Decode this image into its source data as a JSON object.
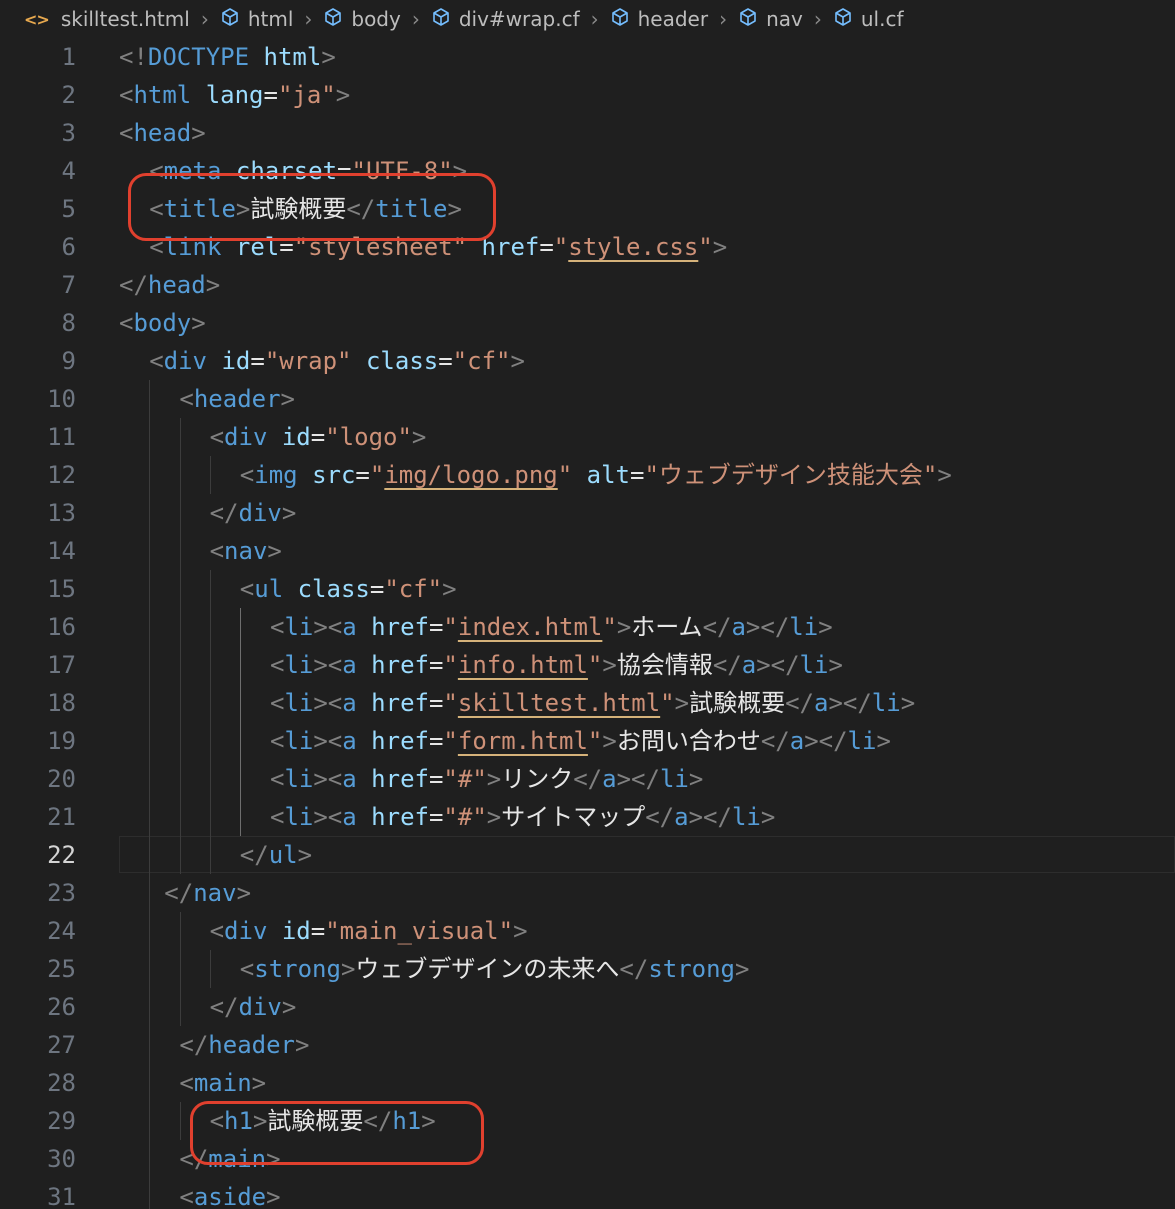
{
  "breadcrumb": {
    "file_icon": "<>",
    "items": [
      "skilltest.html",
      "html",
      "body",
      "div#wrap.cf",
      "header",
      "nav",
      "ul.cf"
    ]
  },
  "editor": {
    "current_line": 22,
    "lines": [
      {
        "n": "1",
        "indent": 0,
        "tokens": [
          [
            "t",
            "<!"
          ],
          [
            "tag",
            "DOCTYPE"
          ],
          [
            "t",
            " "
          ],
          [
            "attr",
            "html"
          ],
          [
            "t",
            ">"
          ]
        ]
      },
      {
        "n": "2",
        "indent": 0,
        "tokens": [
          [
            "t",
            "<"
          ],
          [
            "tag",
            "html"
          ],
          [
            "t",
            " "
          ],
          [
            "attr",
            "lang"
          ],
          [
            "txt",
            "="
          ],
          [
            "str",
            "\"ja\""
          ],
          [
            "t",
            ">"
          ]
        ]
      },
      {
        "n": "3",
        "indent": 0,
        "tokens": [
          [
            "t",
            "<"
          ],
          [
            "tag",
            "head"
          ],
          [
            "t",
            ">"
          ]
        ]
      },
      {
        "n": "4",
        "indent": 1,
        "tokens": [
          [
            "t",
            "<"
          ],
          [
            "tag",
            "meta"
          ],
          [
            "t",
            " "
          ],
          [
            "attr",
            "charset"
          ],
          [
            "txt",
            "="
          ],
          [
            "str",
            "\"UTF-8\""
          ],
          [
            "t",
            ">"
          ]
        ]
      },
      {
        "n": "5",
        "indent": 1,
        "tokens": [
          [
            "t",
            "<"
          ],
          [
            "tag",
            "title"
          ],
          [
            "t",
            ">"
          ],
          [
            "txt",
            "試験概要"
          ],
          [
            "t",
            "</"
          ],
          [
            "tag",
            "title"
          ],
          [
            "t",
            ">"
          ]
        ]
      },
      {
        "n": "6",
        "indent": 1,
        "tokens": [
          [
            "t",
            "<"
          ],
          [
            "tag",
            "link"
          ],
          [
            "t",
            " "
          ],
          [
            "attr",
            "rel"
          ],
          [
            "txt",
            "="
          ],
          [
            "str",
            "\"stylesheet\""
          ],
          [
            "t",
            " "
          ],
          [
            "attr",
            "href"
          ],
          [
            "txt",
            "="
          ],
          [
            "str",
            "\""
          ],
          [
            "link",
            "style.css"
          ],
          [
            "str",
            "\""
          ],
          [
            "t",
            ">"
          ]
        ]
      },
      {
        "n": "7",
        "indent": 0,
        "tokens": [
          [
            "t",
            "</"
          ],
          [
            "tag",
            "head"
          ],
          [
            "t",
            ">"
          ]
        ]
      },
      {
        "n": "8",
        "indent": 0,
        "tokens": [
          [
            "t",
            "<"
          ],
          [
            "tag",
            "body"
          ],
          [
            "t",
            ">"
          ]
        ]
      },
      {
        "n": "9",
        "indent": 1,
        "tokens": [
          [
            "t",
            "<"
          ],
          [
            "tag",
            "div"
          ],
          [
            "t",
            " "
          ],
          [
            "attr",
            "id"
          ],
          [
            "txt",
            "="
          ],
          [
            "str",
            "\"wrap\""
          ],
          [
            "t",
            " "
          ],
          [
            "attr",
            "class"
          ],
          [
            "txt",
            "="
          ],
          [
            "str",
            "\"cf\""
          ],
          [
            "t",
            ">"
          ]
        ]
      },
      {
        "n": "10",
        "indent": 2,
        "tokens": [
          [
            "t",
            "<"
          ],
          [
            "tag",
            "header"
          ],
          [
            "t",
            ">"
          ]
        ]
      },
      {
        "n": "11",
        "indent": 3,
        "tokens": [
          [
            "t",
            "<"
          ],
          [
            "tag",
            "div"
          ],
          [
            "t",
            " "
          ],
          [
            "attr",
            "id"
          ],
          [
            "txt",
            "="
          ],
          [
            "str",
            "\"logo\""
          ],
          [
            "t",
            ">"
          ]
        ]
      },
      {
        "n": "12",
        "indent": 4,
        "tokens": [
          [
            "t",
            "<"
          ],
          [
            "tag",
            "img"
          ],
          [
            "t",
            " "
          ],
          [
            "attr",
            "src"
          ],
          [
            "txt",
            "="
          ],
          [
            "str",
            "\""
          ],
          [
            "link",
            "img/logo.png"
          ],
          [
            "str",
            "\""
          ],
          [
            "t",
            " "
          ],
          [
            "attr",
            "alt"
          ],
          [
            "txt",
            "="
          ],
          [
            "str",
            "\"ウェブデザイン技能大会\""
          ],
          [
            "t",
            ">"
          ]
        ]
      },
      {
        "n": "13",
        "indent": 3,
        "tokens": [
          [
            "t",
            "</"
          ],
          [
            "tag",
            "div"
          ],
          [
            "t",
            ">"
          ]
        ]
      },
      {
        "n": "14",
        "indent": 3,
        "tokens": [
          [
            "t",
            "<"
          ],
          [
            "tag",
            "nav"
          ],
          [
            "t",
            ">"
          ]
        ]
      },
      {
        "n": "15",
        "indent": 4,
        "tokens": [
          [
            "t",
            "<"
          ],
          [
            "tag",
            "ul"
          ],
          [
            "t",
            " "
          ],
          [
            "attr",
            "class"
          ],
          [
            "txt",
            "="
          ],
          [
            "str",
            "\"cf\""
          ],
          [
            "t",
            ">"
          ]
        ]
      },
      {
        "n": "16",
        "indent": 5,
        "tokens": [
          [
            "t",
            "<"
          ],
          [
            "tag",
            "li"
          ],
          [
            "t",
            "><"
          ],
          [
            "tag",
            "a"
          ],
          [
            "t",
            " "
          ],
          [
            "attr",
            "href"
          ],
          [
            "txt",
            "="
          ],
          [
            "str",
            "\""
          ],
          [
            "link",
            "index.html"
          ],
          [
            "str",
            "\""
          ],
          [
            "t",
            ">"
          ],
          [
            "txt",
            "ホーム"
          ],
          [
            "t",
            "</"
          ],
          [
            "tag",
            "a"
          ],
          [
            "t",
            "></"
          ],
          [
            "tag",
            "li"
          ],
          [
            "t",
            ">"
          ]
        ]
      },
      {
        "n": "17",
        "indent": 5,
        "tokens": [
          [
            "t",
            "<"
          ],
          [
            "tag",
            "li"
          ],
          [
            "t",
            "><"
          ],
          [
            "tag",
            "a"
          ],
          [
            "t",
            " "
          ],
          [
            "attr",
            "href"
          ],
          [
            "txt",
            "="
          ],
          [
            "str",
            "\""
          ],
          [
            "link",
            "info.html"
          ],
          [
            "str",
            "\""
          ],
          [
            "t",
            ">"
          ],
          [
            "txt",
            "協会情報"
          ],
          [
            "t",
            "</"
          ],
          [
            "tag",
            "a"
          ],
          [
            "t",
            "></"
          ],
          [
            "tag",
            "li"
          ],
          [
            "t",
            ">"
          ]
        ]
      },
      {
        "n": "18",
        "indent": 5,
        "tokens": [
          [
            "t",
            "<"
          ],
          [
            "tag",
            "li"
          ],
          [
            "t",
            "><"
          ],
          [
            "tag",
            "a"
          ],
          [
            "t",
            " "
          ],
          [
            "attr",
            "href"
          ],
          [
            "txt",
            "="
          ],
          [
            "str",
            "\""
          ],
          [
            "link",
            "skilltest.html"
          ],
          [
            "str",
            "\""
          ],
          [
            "t",
            ">"
          ],
          [
            "txt",
            "試験概要"
          ],
          [
            "t",
            "</"
          ],
          [
            "tag",
            "a"
          ],
          [
            "t",
            "></"
          ],
          [
            "tag",
            "li"
          ],
          [
            "t",
            ">"
          ]
        ]
      },
      {
        "n": "19",
        "indent": 5,
        "tokens": [
          [
            "t",
            "<"
          ],
          [
            "tag",
            "li"
          ],
          [
            "t",
            "><"
          ],
          [
            "tag",
            "a"
          ],
          [
            "t",
            " "
          ],
          [
            "attr",
            "href"
          ],
          [
            "txt",
            "="
          ],
          [
            "str",
            "\""
          ],
          [
            "link",
            "form.html"
          ],
          [
            "str",
            "\""
          ],
          [
            "t",
            ">"
          ],
          [
            "txt",
            "お問い合わせ"
          ],
          [
            "t",
            "</"
          ],
          [
            "tag",
            "a"
          ],
          [
            "t",
            "></"
          ],
          [
            "tag",
            "li"
          ],
          [
            "t",
            ">"
          ]
        ]
      },
      {
        "n": "20",
        "indent": 5,
        "tokens": [
          [
            "t",
            "<"
          ],
          [
            "tag",
            "li"
          ],
          [
            "t",
            "><"
          ],
          [
            "tag",
            "a"
          ],
          [
            "t",
            " "
          ],
          [
            "attr",
            "href"
          ],
          [
            "txt",
            "="
          ],
          [
            "str",
            "\"#\""
          ],
          [
            "t",
            ">"
          ],
          [
            "txt",
            "リンク"
          ],
          [
            "t",
            "</"
          ],
          [
            "tag",
            "a"
          ],
          [
            "t",
            "></"
          ],
          [
            "tag",
            "li"
          ],
          [
            "t",
            ">"
          ]
        ]
      },
      {
        "n": "21",
        "indent": 5,
        "tokens": [
          [
            "t",
            "<"
          ],
          [
            "tag",
            "li"
          ],
          [
            "t",
            "><"
          ],
          [
            "tag",
            "a"
          ],
          [
            "t",
            " "
          ],
          [
            "attr",
            "href"
          ],
          [
            "txt",
            "="
          ],
          [
            "str",
            "\"#\""
          ],
          [
            "t",
            ">"
          ],
          [
            "txt",
            "サイトマップ"
          ],
          [
            "t",
            "</"
          ],
          [
            "tag",
            "a"
          ],
          [
            "t",
            "></"
          ],
          [
            "tag",
            "li"
          ],
          [
            "t",
            ">"
          ]
        ]
      },
      {
        "n": "22",
        "indent": 4,
        "tokens": [
          [
            "t",
            "</"
          ],
          [
            "tag",
            "ul"
          ],
          [
            "t",
            ">"
          ]
        ]
      },
      {
        "n": "23",
        "indent": 1.5,
        "tokens": [
          [
            "t",
            "</"
          ],
          [
            "tag",
            "nav"
          ],
          [
            "t",
            ">"
          ]
        ]
      },
      {
        "n": "24",
        "indent": 3,
        "tokens": [
          [
            "t",
            "<"
          ],
          [
            "tag",
            "div"
          ],
          [
            "t",
            " "
          ],
          [
            "attr",
            "id"
          ],
          [
            "txt",
            "="
          ],
          [
            "str",
            "\"main_visual\""
          ],
          [
            "t",
            ">"
          ]
        ]
      },
      {
        "n": "25",
        "indent": 4,
        "tokens": [
          [
            "t",
            "<"
          ],
          [
            "tag",
            "strong"
          ],
          [
            "t",
            ">"
          ],
          [
            "txt",
            "ウェブデザインの未来へ"
          ],
          [
            "t",
            "</"
          ],
          [
            "tag",
            "strong"
          ],
          [
            "t",
            ">"
          ]
        ]
      },
      {
        "n": "26",
        "indent": 3,
        "tokens": [
          [
            "t",
            "</"
          ],
          [
            "tag",
            "div"
          ],
          [
            "t",
            ">"
          ]
        ]
      },
      {
        "n": "27",
        "indent": 2,
        "tokens": [
          [
            "t",
            "</"
          ],
          [
            "tag",
            "header"
          ],
          [
            "t",
            ">"
          ]
        ]
      },
      {
        "n": "28",
        "indent": 2,
        "tokens": [
          [
            "t",
            "<"
          ],
          [
            "tag",
            "main"
          ],
          [
            "t",
            ">"
          ]
        ]
      },
      {
        "n": "29",
        "indent": 3,
        "tokens": [
          [
            "t",
            "<"
          ],
          [
            "tag",
            "h1"
          ],
          [
            "t",
            ">"
          ],
          [
            "txt",
            "試験概要"
          ],
          [
            "t",
            "</"
          ],
          [
            "tag",
            "h1"
          ],
          [
            "t",
            ">"
          ]
        ]
      },
      {
        "n": "30",
        "indent": 2,
        "tokens": [
          [
            "t",
            "</"
          ],
          [
            "tag",
            "main"
          ],
          [
            "t",
            ">"
          ]
        ]
      },
      {
        "n": "31",
        "indent": 2,
        "tokens": [
          [
            "t",
            "<"
          ],
          [
            "tag",
            "aside"
          ],
          [
            "t",
            ">"
          ]
        ]
      }
    ]
  },
  "colors": {
    "background": "#1f1f1f",
    "tag": "#569cd6",
    "attribute": "#9cdcfe",
    "string": "#ce9178",
    "punctuation": "#808080",
    "annotation": "#e0402e"
  }
}
